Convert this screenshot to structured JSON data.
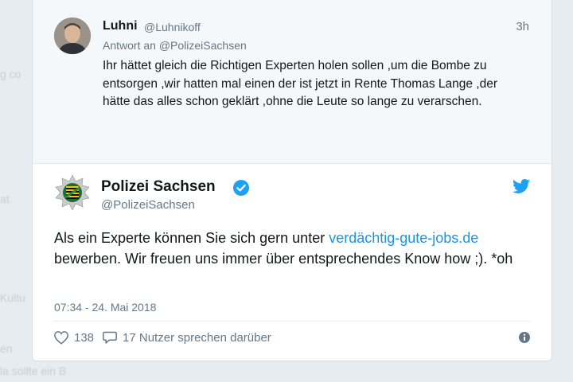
{
  "background_fragments": [
    "g co",
    "at",
    "Kultu",
    "en",
    "la sollte ein B"
  ],
  "parent_tweet": {
    "display_name": "Luhni",
    "handle": "@Luhnikoff",
    "time": "3h",
    "reply_prefix": "Antwort an",
    "reply_handle": "@PolizeiSachsen",
    "text": "Ihr hättet gleich die Richtigen Experten holen sollen ,um die Bombe zu entsorgen ,wir hatten mal einen der ist jetzt in Rente Thomas Lange ,der hätte das alles schon geklärt ,ohne die Leute so lange zu verarschen."
  },
  "main_tweet": {
    "display_name": "Polizei Sachsen",
    "handle": "@PolizeiSachsen",
    "text_before_link": "Als ein Experte können Sie sich gern unter ",
    "link_text": "verdächtig-gute-jobs.de",
    "text_after_link": " bewerben. Wir freuen uns immer über entsprechendes Know how ;). *oh",
    "timestamp": "07:34 - 24. Mai 2018",
    "likes": "138",
    "conversation_text": "17 Nutzer sprechen darüber"
  },
  "icons": {
    "verified": "verified-badge-icon",
    "bird": "twitter-bird-icon",
    "like": "heart-icon",
    "reply": "speech-bubble-icon",
    "info": "info-icon"
  },
  "colors": {
    "link": "#1b95e0",
    "verified": "#1da1f2",
    "secondary_text": "#657786",
    "parent_bg": "#f5f8fa",
    "page_bg": "#e6ecf0"
  }
}
